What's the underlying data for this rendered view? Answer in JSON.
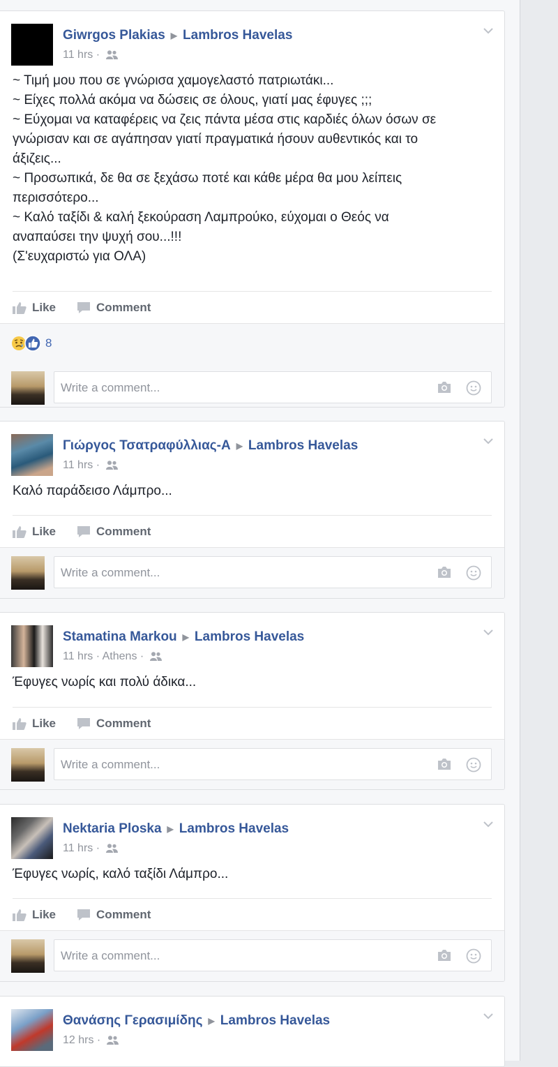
{
  "posts": [
    {
      "author": "Giwrgos Plakias",
      "target": "Lambros Havelas",
      "time": "11 hrs",
      "location": "",
      "lines": [
        "~ Τιμή μου που σε γνώρισα χαμογελαστό πατριωτάκι...",
        "~ Είχες πολλά ακόμα να δώσεις σε όλους, γιατί μας έφυγες ;;;",
        "~ Εύχομαι να καταφέρεις να ζεις πάντα μέσα στις καρδιές όλων όσων σε",
        "γνώρισαν και σε αγάπησαν γιατί πραγματικά ήσουν αυθεντικός και το",
        "άξιζεις...",
        "~ Προσωπικά, δε θα σε ξεχάσω ποτέ και κάθε μέρα θα μου λείπεις",
        "περισσότερο...",
        "~ Καλό ταξίδι & καλή ξεκούραση Λαμπρούκο, εύχομαι ο Θεός να",
        "αναπαύσει την ψυχή σου...!!!",
        "(Σ'ευχαριστώ για ΟΛΑ)"
      ],
      "reaction_count": "8"
    },
    {
      "author": "Γιώργος Τσατραφύλλιας-Α",
      "target": "Lambros Havelas",
      "time": "11 hrs",
      "location": "",
      "lines": [
        "Καλό παράδεισο Λάμπρο..."
      ]
    },
    {
      "author": "Stamatina Markou",
      "target": "Lambros Havelas",
      "time": "11 hrs",
      "location": "Athens",
      "lines": [
        "Έφυγες νωρίς και πολύ άδικα..."
      ]
    },
    {
      "author": "Nektaria Ploska",
      "target": "Lambros Havelas",
      "time": "11 hrs",
      "location": "",
      "lines": [
        "Έφυγες νωρίς, καλό ταξίδι Λάμπρο..."
      ]
    },
    {
      "author": "Θανάσης Γερασιμίδης",
      "target": "Lambros Havelas",
      "time": "12 hrs",
      "location": ""
    }
  ],
  "ui": {
    "like_label": "Like",
    "comment_label": "Comment",
    "comment_placeholder": "Write a comment...",
    "time_separator": " · "
  },
  "icons": {
    "privacy": "friends-icon",
    "menu": "chevron-down-icon",
    "like": "thumbs-up-icon",
    "comment": "speech-bubble-icon",
    "camera": "camera-icon",
    "emoji": "smiley-icon",
    "reactions": [
      "sad-reaction-icon",
      "like-reaction-icon"
    ]
  },
  "colors": {
    "link": "#365899",
    "meta": "#90949c",
    "action": "#616770",
    "like_blue": "#4267b2",
    "sad_yellow": "#f7c948"
  }
}
